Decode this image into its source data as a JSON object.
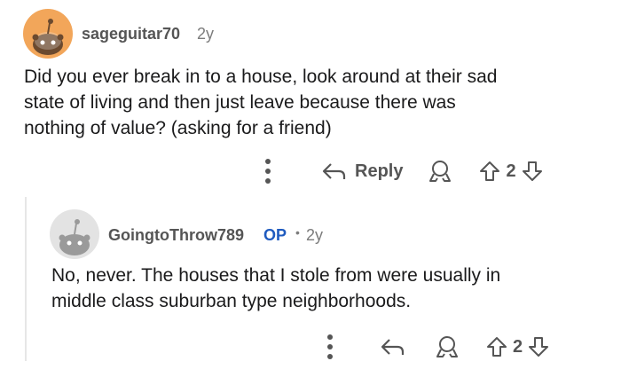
{
  "comment1": {
    "username": "sageguitar70",
    "age": "2y",
    "body_lines": [
      "Did you ever break in to a house, look around at their sad",
      "state of living and then just leave because there was",
      "nothing of value? (asking for a friend)"
    ],
    "reply_label": "Reply",
    "vote_count": "2"
  },
  "comment2": {
    "username": "GoingtoThrow789",
    "op_badge": "OP",
    "separator": "•",
    "age": "2y",
    "body_lines": [
      "No, never. The houses that I stole from were usually in",
      "middle class suburban type neighborhoods."
    ],
    "vote_count": "2"
  },
  "colors": {
    "avatar1_bg": "#f2a65a",
    "avatar2_bg": "#e3e3e3",
    "op_blue": "#1f5bbf"
  },
  "icons": [
    "more-vertical-icon",
    "reply-arrow-icon",
    "award-icon",
    "upvote-icon",
    "downvote-icon"
  ]
}
